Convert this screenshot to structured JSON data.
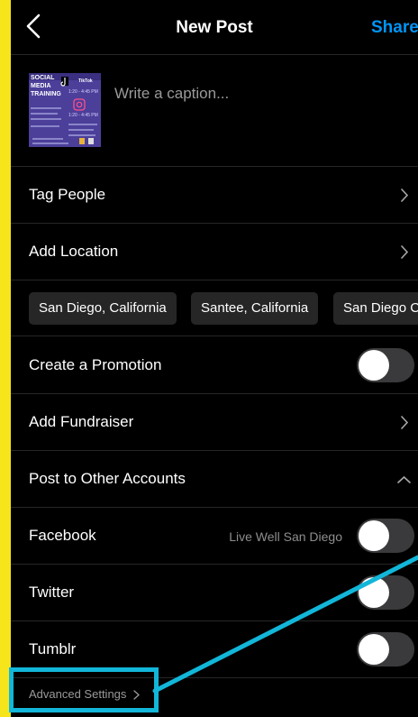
{
  "header": {
    "title": "New Post",
    "share_label": "Share"
  },
  "caption": {
    "placeholder": "Write a caption..."
  },
  "thumbnail": {
    "line1": "SOCIAL",
    "line2": "MEDIA",
    "line3": "TRAINING",
    "tiktok": "TikTok",
    "tiktok_time": "1:20 - 4:45 PM",
    "instagram_time": "1:20 - 4:45 PM"
  },
  "rows": {
    "tag_people": "Tag People",
    "add_location": "Add Location",
    "create_promotion": "Create a Promotion",
    "add_fundraiser": "Add Fundraiser",
    "post_to_other_accounts": "Post to Other Accounts",
    "facebook": "Facebook",
    "facebook_account": "Live Well San Diego",
    "twitter": "Twitter",
    "tumblr": "Tumblr"
  },
  "location_chips": [
    "San Diego, California",
    "Santee, California",
    "San Diego C"
  ],
  "toggles": {
    "create_promotion": false,
    "facebook": false,
    "twitter": false,
    "tumblr": false
  },
  "advanced_settings_label": "Advanced Settings",
  "colors": {
    "accent": "#0095f6",
    "highlight": "#12b6d9",
    "side_bar": "#f5e51a"
  },
  "icons": {
    "back": "chevron-left-icon",
    "row_chevron": "chevron-right-icon",
    "expand": "chevron-up-icon"
  }
}
